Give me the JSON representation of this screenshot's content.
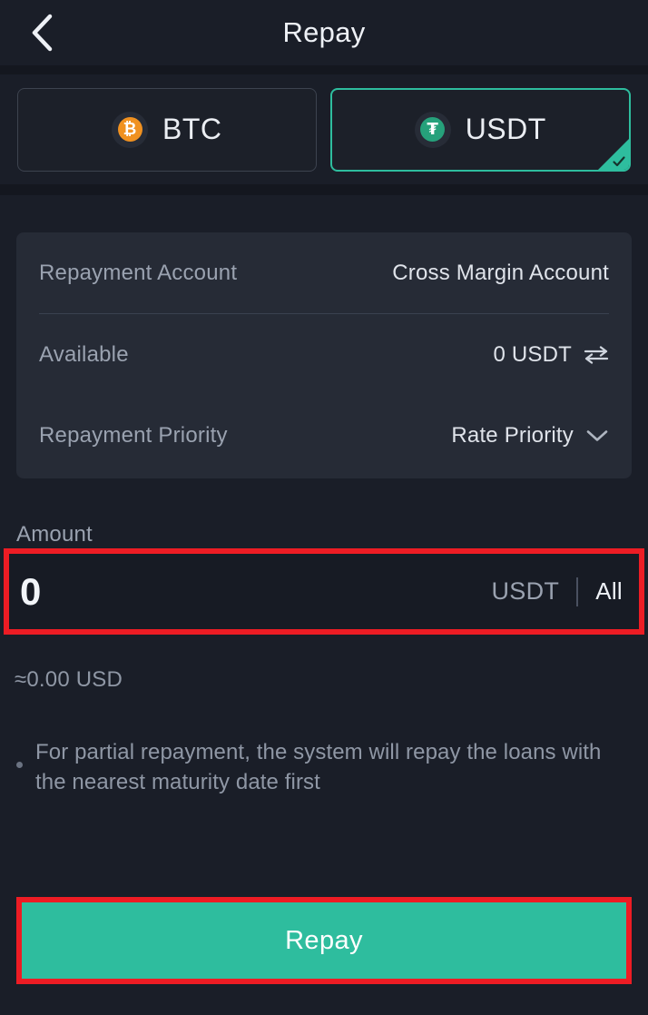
{
  "header": {
    "title": "Repay",
    "back_icon": "chevron-left-icon"
  },
  "tabs": [
    {
      "label": "BTC",
      "symbol": "₿",
      "icon": "btc-coin-icon",
      "selected": false,
      "color": "#f09120"
    },
    {
      "label": "USDT",
      "symbol": "₮",
      "icon": "usdt-coin-icon",
      "selected": true,
      "color": "#26a17b"
    }
  ],
  "info_card": {
    "rows": [
      {
        "label": "Repayment Account",
        "value": "Cross Margin Account",
        "icon": ""
      },
      {
        "label": "Available",
        "value": "0 USDT",
        "icon": "swap-icon"
      },
      {
        "label": "Repayment Priority",
        "value": "Rate Priority",
        "icon": "chevron-down-icon"
      }
    ]
  },
  "amount": {
    "label": "Amount",
    "value": "0",
    "placeholder": "0",
    "unit": "USDT",
    "all_label": "All",
    "approx": "≈0.00 USD"
  },
  "note": {
    "text": "For partial repayment, the system will repay the loans with the nearest maturity date first"
  },
  "action": {
    "repay_label": "Repay"
  },
  "colors": {
    "accent_green": "#2ebd9e",
    "annotation_red": "#ed1c24",
    "page_bg": "#1a1e28",
    "card_bg": "#262b36",
    "input_bg": "#171b24",
    "text_primary": "#eef1f6",
    "text_muted": "#9aa2b0"
  }
}
